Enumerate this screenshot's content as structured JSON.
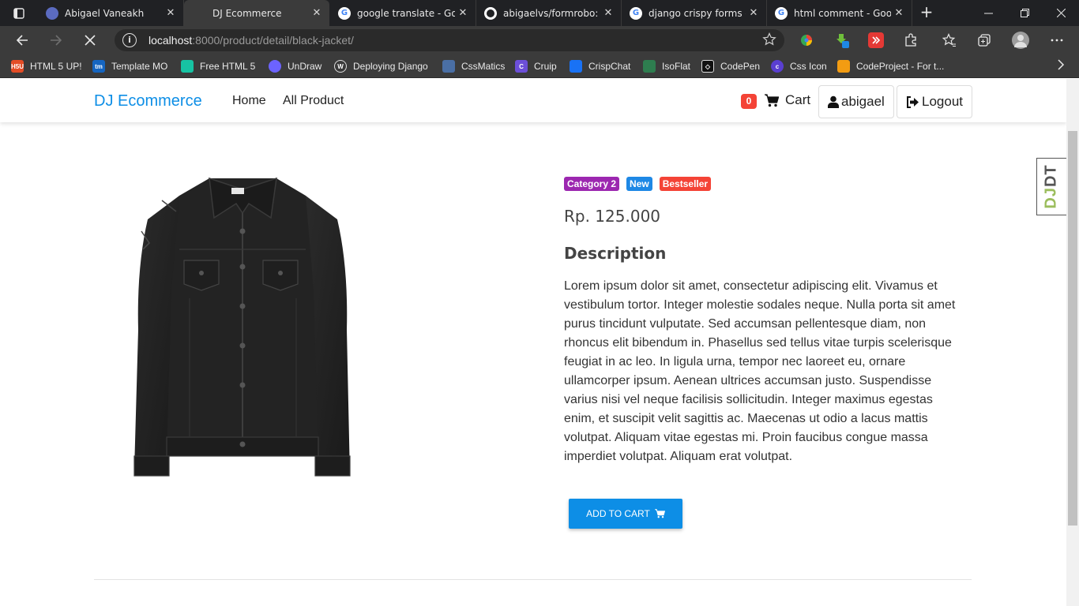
{
  "browser": {
    "tabs": [
      {
        "title": "Abigael Vaneakh",
        "favicon": "avatar-favicon",
        "active": false
      },
      {
        "title": "DJ Ecommerce",
        "favicon": "loading",
        "active": true
      },
      {
        "title": "google translate - Goo",
        "favicon": "google-favicon",
        "active": false
      },
      {
        "title": "abigaelvs/formrobo: A",
        "favicon": "github-favicon",
        "active": false
      },
      {
        "title": "django crispy forms - ",
        "favicon": "google-favicon",
        "active": false
      },
      {
        "title": "html comment - Goog",
        "favicon": "google-favicon",
        "active": false
      }
    ],
    "close_glyph": "✕",
    "new_tab_glyph": "+",
    "url_host": "localhost",
    "url_path": ":8000/product/detail/black-jacket/",
    "info_glyph": "i",
    "bookmarks": [
      {
        "label": "HTML 5 UP!",
        "icon": "html5up-icon",
        "color": "#e44d26",
        "abbr": "H5U"
      },
      {
        "label": "Template MO",
        "icon": "templatemo-icon",
        "color": "#1565c0",
        "abbr": "tm"
      },
      {
        "label": "Free HTML 5",
        "icon": "freehtml5-icon",
        "color": "#17c3a3",
        "abbr": ""
      },
      {
        "label": "UnDraw",
        "icon": "undraw-icon",
        "color": "#6c63ff",
        "abbr": ""
      },
      {
        "label": "Deploying Django",
        "icon": "wordpress-icon",
        "color": "#3a3a3a",
        "abbr": "W"
      },
      {
        "label": "CssMatics",
        "icon": "cssmatics-icon",
        "color": "#4a6fa5",
        "abbr": ""
      },
      {
        "label": "Cruip",
        "icon": "cruip-icon",
        "color": "#6c4fd8",
        "abbr": "C"
      },
      {
        "label": "CrispChat",
        "icon": "crispchat-icon",
        "color": "#1972f5",
        "abbr": ""
      },
      {
        "label": "IsoFlat",
        "icon": "isoflat-icon",
        "color": "#2e7d4f",
        "abbr": ""
      },
      {
        "label": "CodePen",
        "icon": "codepen-icon",
        "color": "#111111",
        "abbr": "◇"
      },
      {
        "label": "Css Icon",
        "icon": "cssicon-icon",
        "color": "#5a3fd1",
        "abbr": "c"
      },
      {
        "label": "CodeProject - For t...",
        "icon": "codeproject-icon",
        "color": "#f39c12",
        "abbr": ""
      }
    ]
  },
  "site": {
    "brand": "DJ Ecommerce",
    "nav": {
      "home": "Home",
      "all_product": "All Product"
    },
    "cart_count": "0",
    "cart_label": "Cart",
    "username": "abigael",
    "logout_label": "Logout",
    "accent_color": "#0d8ee6"
  },
  "debug_toolbar": {
    "prefix": "DJ",
    "suffix": "DT"
  },
  "product": {
    "badges": [
      {
        "label": "Category 2",
        "color": "#9c27b0"
      },
      {
        "label": "New",
        "color": "#1e88e5"
      },
      {
        "label": "Bestseller",
        "color": "#f44336"
      }
    ],
    "price": "Rp. 125.000",
    "description_title": "Description",
    "description": "Lorem ipsum dolor sit amet, consectetur adipiscing elit. Vivamus et vestibulum tortor. Integer molestie sodales neque. Nulla porta sit amet purus tincidunt vulputate. Sed accumsan pellentesque diam, non rhoncus elit bibendum in. Phasellus sed tellus vitae turpis scelerisque feugiat in ac leo. In ligula urna, tempor nec laoreet eu, ornare ullamcorper ipsum. Aenean ultrices accumsan justo. Suspendisse varius nisi vel neque facilisis sollicitudin. Integer maximus egestas enim, et suscipit velit sagittis ac. Maecenas ut odio a lacus mattis volutpat. Aliquam vitae egestas mi. Proin faucibus congue massa imperdiet volutpat. Aliquam erat volutpat.",
    "add_to_cart": "ADD TO CART"
  }
}
